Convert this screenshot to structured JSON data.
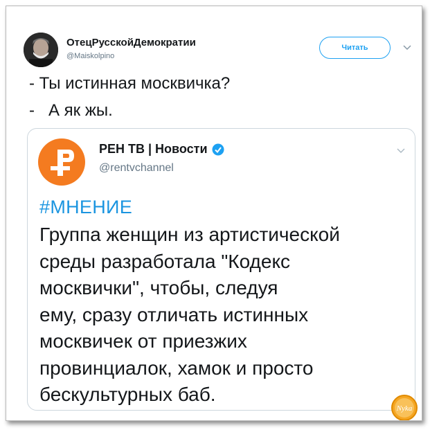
{
  "tweet": {
    "author_name": "ОтецРусскойДемократии",
    "author_handle": "@Maiskolpino",
    "follow_label": "Читать",
    "lines": [
      "- Ты истинная москвичка?",
      "-   А як жы."
    ]
  },
  "quoted": {
    "name": "РЕН ТВ | Новости",
    "handle": "@rentvchannel",
    "hashtag": "#МНЕНИЕ",
    "body_lines": [
      "Группа женщин из артистической",
      "среды разработала \"Кодекс",
      "москвички\", чтобы, следуя",
      "ему, сразу отличать истинных",
      "москвичек от приезжих",
      "провинциалок, хамок и просто",
      "бескультурных баб."
    ]
  },
  "watermark": {
    "text": "Nyka"
  },
  "colors": {
    "accent": "#1da1f2",
    "hashtag": "#1b95e0",
    "ren_orange": "#f47b20",
    "text": "#14171a",
    "muted": "#657786"
  },
  "icons": [
    "chevron-down-icon",
    "verified-badge-icon",
    "ren-tv-logo",
    "avatar"
  ]
}
